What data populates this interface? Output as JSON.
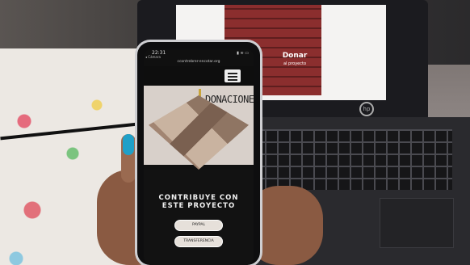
{
  "laptop": {
    "screen_badge_line1": "Donar",
    "screen_badge_line2": "al proyecto"
  },
  "phone": {
    "status_time": "22:31",
    "status_back": "◂ Cámara",
    "status_indicators": "▮ ≋ ▭",
    "url": "ccontrebrer-encotar.org",
    "hero_title": "DONACIONES",
    "cta_line1": "CONTRIBUYE CON",
    "cta_line2": "ESTE PROYECTO",
    "button_paypal": "PAYPAL",
    "button_transfer": "TRANSFERENCIA"
  }
}
